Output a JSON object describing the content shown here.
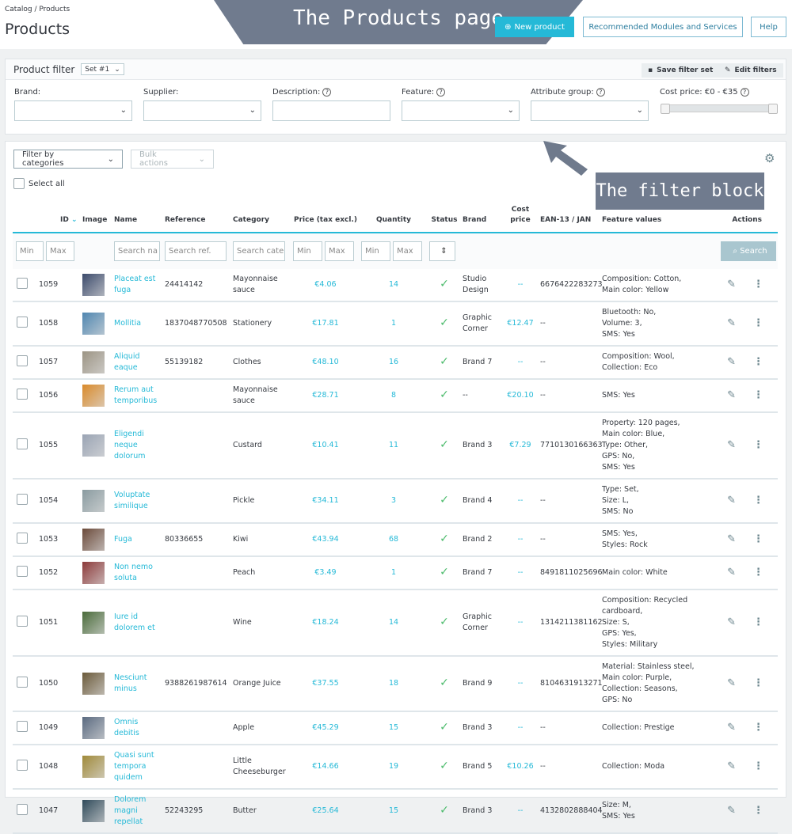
{
  "header": {
    "breadcrumb": [
      "Catalog",
      "Products"
    ],
    "title": "Products",
    "new_product": "New product",
    "recommended": "Recommended Modules and Services",
    "help": "Help"
  },
  "filter": {
    "title": "Product filter",
    "set": "Set #1",
    "save": "Save filter set",
    "edit": "Edit filters",
    "labels": {
      "brand": "Brand:",
      "supplier": "Supplier:",
      "description": "Description:",
      "feature": "Feature:",
      "attribute": "Attribute group:",
      "cost": "Cost price: €0 - €35"
    },
    "cost_range": [
      0,
      35
    ]
  },
  "toolbar": {
    "filter_categories": "Filter by categories",
    "bulk": "Bulk actions",
    "select_all": "Select all"
  },
  "columns": {
    "id": "ID",
    "image": "Image",
    "name": "Name",
    "reference": "Reference",
    "category": "Category",
    "price": "Price (tax excl.)",
    "quantity": "Quantity",
    "status": "Status",
    "brand": "Brand",
    "cost": "Cost price",
    "ean": "EAN-13 / JAN",
    "features": "Feature values",
    "actions": "Actions"
  },
  "search_row": {
    "min": "Min",
    "max": "Max",
    "name": "Search na",
    "ref": "Search ref.",
    "cat": "Search cate",
    "search": "Search"
  },
  "rows": [
    {
      "id": "1059",
      "name": "Placeat est fuga",
      "ref": "24414142",
      "cat": "Mayonnaise sauce",
      "price": "€4.06",
      "qty": "14",
      "brand": "Studio Design",
      "cost": "--",
      "ean": "6676422283273",
      "features": "Composition: Cotton,\nMain color: Yellow",
      "img": "#3b4a6b"
    },
    {
      "id": "1058",
      "name": "Mollitia",
      "ref": "1837048770508",
      "cat": "Stationery",
      "price": "€17.81",
      "qty": "1",
      "brand": "Graphic Corner",
      "cost": "€12.47",
      "ean": "--",
      "features": "Bluetooth: No,\nVolume: 3,\nSMS: Yes",
      "img": "#4f86b0"
    },
    {
      "id": "1057",
      "name": "Aliquid eaque",
      "ref": "55139182",
      "cat": "Clothes",
      "price": "€48.10",
      "qty": "16",
      "brand": "Brand 7",
      "cost": "--",
      "ean": "--",
      "features": "Composition: Wool,\nCollection: Eco",
      "img": "#9c9484"
    },
    {
      "id": "1056",
      "name": "Rerum aut temporibus",
      "ref": "",
      "cat": "Mayonnaise sauce",
      "price": "€28.71",
      "qty": "8",
      "brand": "--",
      "cost": "€20.10",
      "ean": "--",
      "features": "SMS: Yes",
      "img": "#d98a2b"
    },
    {
      "id": "1055",
      "name": "Eligendi neque dolorum",
      "ref": "",
      "cat": "Custard",
      "price": "€10.41",
      "qty": "11",
      "brand": "Brand 3",
      "cost": "€7.29",
      "ean": "7710130166363",
      "features": "Property: 120 pages,\nMain color: Blue,\nType: Other,\nGPS: No,\nSMS: Yes",
      "img": "#9aa4b4"
    },
    {
      "id": "1054",
      "name": "Voluptate similique",
      "ref": "",
      "cat": "Pickle",
      "price": "€34.11",
      "qty": "3",
      "brand": "Brand 4",
      "cost": "--",
      "ean": "--",
      "features": "Type: Set,\nSize: L,\nSMS: No",
      "img": "#8a9ba0"
    },
    {
      "id": "1053",
      "name": "Fuga",
      "ref": "80336655",
      "cat": "Kiwi",
      "price": "€43.94",
      "qty": "68",
      "brand": "Brand 2",
      "cost": "--",
      "ean": "--",
      "features": "SMS: Yes,\nStyles: Rock",
      "img": "#6b4a3a"
    },
    {
      "id": "1052",
      "name": "Non nemo soluta",
      "ref": "",
      "cat": "Peach",
      "price": "€3.49",
      "qty": "1",
      "brand": "Brand 7",
      "cost": "--",
      "ean": "8491811025696",
      "features": "Main color: White",
      "img": "#8c3a3a"
    },
    {
      "id": "1051",
      "name": "Iure id dolorem et",
      "ref": "",
      "cat": "Wine",
      "price": "€18.24",
      "qty": "14",
      "brand": "Graphic Corner",
      "cost": "--",
      "ean": "1314211381162",
      "features": "Composition: Recycled cardboard,\nSize: S,\nGPS: Yes,\nStyles: Military",
      "img": "#4a6b3a"
    },
    {
      "id": "1050",
      "name": "Nesciunt minus",
      "ref": "9388261987614",
      "cat": "Orange Juice",
      "price": "€37.55",
      "qty": "18",
      "brand": "Brand 9",
      "cost": "--",
      "ean": "8104631913271",
      "features": "Material: Stainless steel,\nMain color: Purple,\nCollection: Seasons,\nGPS: No",
      "img": "#6b5a3a"
    },
    {
      "id": "1049",
      "name": "Omnis debitis",
      "ref": "",
      "cat": "Apple",
      "price": "€45.29",
      "qty": "15",
      "brand": "Brand 3",
      "cost": "--",
      "ean": "--",
      "features": "Collection: Prestige",
      "img": "#5a6a80"
    },
    {
      "id": "1048",
      "name": "Quasi sunt tempora quidem",
      "ref": "",
      "cat": "Little Cheeseburger",
      "price": "€14.66",
      "qty": "19",
      "brand": "Brand 5",
      "cost": "€10.26",
      "ean": "--",
      "features": "Collection: Moda",
      "img": "#a08a3a"
    },
    {
      "id": "1047",
      "name": "Dolorem magni repellat",
      "ref": "52243295",
      "cat": "Butter",
      "price": "€25.64",
      "qty": "15",
      "brand": "Brand 3",
      "cost": "--",
      "ean": "4132802888404",
      "features": "Size: M,\nSMS: Yes",
      "img": "#2f4a5a"
    }
  ],
  "annotations": {
    "top": "The Products page",
    "filter": "The filter block"
  },
  "colors": {
    "accent": "#25b9d7",
    "check": "#4cbb6c",
    "overlay": "#6f7a8c"
  }
}
